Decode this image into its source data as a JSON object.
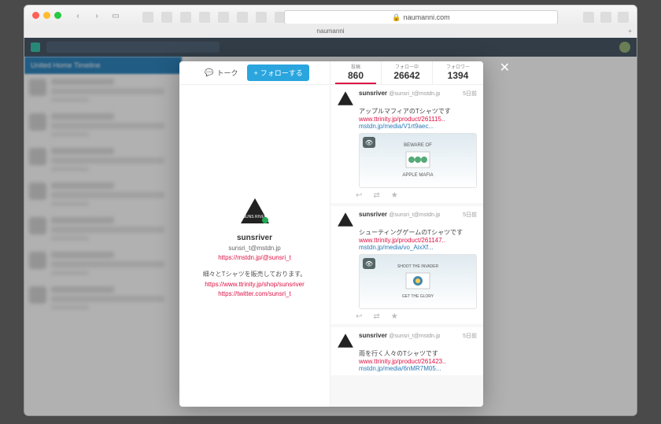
{
  "browser": {
    "url": "naumanni.com",
    "tab_title": "naumanni"
  },
  "app": {
    "column_header": "United Home Timeline"
  },
  "modal": {
    "talk_label": "トーク",
    "follow_label": "フォローする",
    "stats": {
      "posts_label": "投稿",
      "posts_count": "860",
      "following_label": "フォロー中",
      "following_count": "26642",
      "followers_label": "フォロワー",
      "followers_count": "1394"
    },
    "profile": {
      "username": "sunsriver",
      "handle": "sunsri_t@mstdn.jp",
      "profile_link": "https://mstdn.jp/@sunsri_t",
      "bio": "細々とTシャツを販売しております。",
      "shop_link": "https://www.ttrinity.jp/shop/sunsriver",
      "twitter_link": "https://twitter.com/sunsri_t"
    },
    "posts": [
      {
        "username": "sunsriver",
        "handle": "@sunsri_t@mstdn.jp",
        "time": "5日前",
        "text": "アップルマフィアのTシャツです",
        "link1": "www.ttrinity.jp/product/261115..",
        "link2": "mstdn.jp/media/V1rt9aec...",
        "caption_top": "BEWARE OF",
        "caption_bottom": "APPLE MAFIA"
      },
      {
        "username": "sunsriver",
        "handle": "@sunsri_t@mstdn.jp",
        "time": "5日前",
        "text": "シューティングゲームのTシャツです",
        "link1": "www.ttrinity.jp/product/261147..",
        "link2": "mstdn.jp/media/vo_AixXf...",
        "caption_top": "SHOOT THE INVADER",
        "caption_bottom": "GET THE GLORY"
      },
      {
        "username": "sunsriver",
        "handle": "@sunsri_t@mstdn.jp",
        "time": "5日前",
        "text": "雨を行く人々のTシャツです",
        "link1": "www.ttrinity.jp/product/261423..",
        "link2": "mstdn.jp/media/6nMR7M05..."
      }
    ]
  }
}
